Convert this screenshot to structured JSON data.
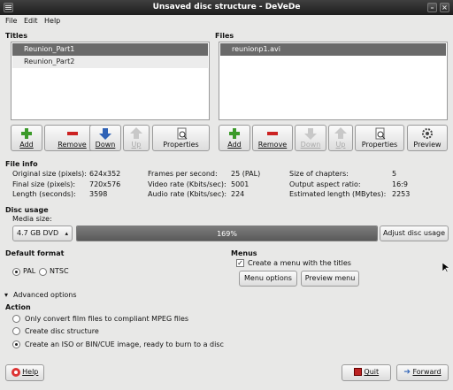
{
  "window": {
    "title": "Unsaved disc structure - DeVeDe",
    "min_symbol": "–",
    "close_symbol": "×"
  },
  "menu": {
    "file": "File",
    "edit": "Edit",
    "help": "Help"
  },
  "titles": {
    "header": "Titles",
    "items": [
      "Reunion_Part1",
      "Reunion_Part2"
    ],
    "selected_index": 0,
    "buttons": {
      "add": "Add",
      "remove": "Remove",
      "down": "Down",
      "up": "Up",
      "properties": "Properties"
    }
  },
  "files": {
    "header": "Files",
    "items": [
      "reunionp1.avi"
    ],
    "selected_index": 0,
    "buttons": {
      "add": "Add",
      "remove": "Remove",
      "down": "Down",
      "up": "Up",
      "properties": "Properties",
      "preview": "Preview"
    }
  },
  "file_info": {
    "header": "File info",
    "original_size_label": "Original size (pixels):",
    "original_size": "624x352",
    "final_size_label": "Final size (pixels):",
    "final_size": "720x576",
    "length_label": "Length (seconds):",
    "length": "3598",
    "fps_label": "Frames per second:",
    "fps": "25 (PAL)",
    "video_rate_label": "Video rate (Kbits/sec):",
    "video_rate": "5001",
    "audio_rate_label": "Audio rate (Kbits/sec):",
    "audio_rate": "224",
    "chapters_label": "Size of chapters:",
    "chapters": "5",
    "aspect_label": "Output aspect ratio:",
    "aspect": "16:9",
    "est_length_label": "Estimated length (MBytes):",
    "est_length": "2253"
  },
  "disc_usage": {
    "header": "Disc usage",
    "media_label": "Media size:",
    "media_value": "4.7 GB DVD",
    "usage_text": "169%",
    "usage_fraction": 1.0,
    "adjust_button": "Adjust disc usage"
  },
  "default_format": {
    "header": "Default format",
    "pal": "PAL",
    "ntsc": "NTSC",
    "selected": "PAL"
  },
  "menus": {
    "header": "Menus",
    "create_menu": "Create a menu with the titles",
    "create_menu_checked": true,
    "menu_options": "Menu options",
    "preview_menu": "Preview menu"
  },
  "advanced": {
    "label": "Advanced options"
  },
  "action": {
    "header": "Action",
    "options": [
      "Only convert film files to compliant MPEG files",
      "Create disc structure",
      "Create an ISO or BIN/CUE image, ready to burn to a disc"
    ],
    "selected_index": 2
  },
  "footer": {
    "help": "Help",
    "quit": "Quit",
    "forward": "Forward"
  }
}
